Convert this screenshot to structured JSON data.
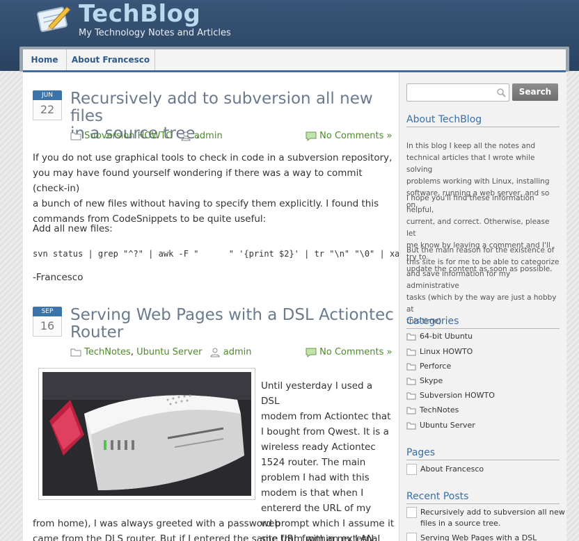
{
  "site": {
    "title": "TechBlog",
    "tagline": "My Technology Notes and Articles"
  },
  "nav": {
    "items": [
      "Home",
      "About Francesco"
    ]
  },
  "posts": [
    {
      "month": "JUN",
      "day": "22",
      "title_line1": "Recursively add to subversion all new files",
      "title_line2": "in a source tree.",
      "category": "Subversion HOWTO",
      "author": "admin",
      "comments": "No Comments »",
      "para1_lines": [
        "If you do not use graphical tools to check in code in a subversion repository,",
        "you may have found yourself wondering if there was a way to commit (check-in)",
        "a bunch of new files without having to specify them explicitly. I found this",
        "commands from CodeSnippets to be quite useful:"
      ],
      "para2": "Add all new files:",
      "code": "svn status | grep \"^?\" | awk -F \"      \" '{print $2}' | tr \"\\n\" \"\\0\" | xa",
      "signature": "-Francesco"
    },
    {
      "month": "SEP",
      "day": "16",
      "title_line1": "Serving Web Pages with a DSL Actiontec",
      "title_line2": "Router",
      "category1": "TechNotes",
      "category_sep": ",",
      "category2": "Ubuntu Server",
      "author": "admin",
      "comments": "No Comments »",
      "wrap_lines": [
        "Until yesterday I used a DSL",
        "modem from Actiontec that",
        "I bought from Qwest. It is a",
        "wireless ready Actiontec",
        "1524 router. The main",
        "problem I had with this",
        "modem is that when I",
        "entererd the URL of my web",
        "site from within my LAN (i.e."
      ],
      "full_lines": [
        "from home), I was always greeted with a password prompt which I assume it",
        "came from the DLS router. But if I entered the same URL from an external"
      ]
    }
  ],
  "sidebar": {
    "search_button": "Search",
    "search_placeholder": "",
    "about_heading": "About TechBlog",
    "about_paras": [
      [
        "In this blog I keep all the notes and",
        "technical articles that I wrote while solving",
        "problems working with Linux, installing",
        "software, running a web server, and so on."
      ],
      [
        "I hope you'll find these information helpful,",
        "current, and correct. Otherwise, please let",
        "me know by leaving a comment and I'll try to",
        "update the content as soon as possible."
      ],
      [
        "But the main reason for the existence of",
        "this site is for me to be able to categorize",
        "and save information for my administrative",
        "tasks (which by the way are just a hobby at",
        "this time)."
      ]
    ],
    "categories_heading": "Categories",
    "categories": [
      "64-bit Ubuntu",
      "Linux HOWTO",
      "Perforce",
      "Skype",
      "Subversion HOWTO",
      "TechNotes",
      "Ubuntu Server"
    ],
    "pages_heading": "Pages",
    "pages": [
      "About Francesco"
    ],
    "recent_heading": "Recent Posts",
    "recent": [
      [
        "Recursively add to subversion all new",
        "files in a source tree."
      ],
      [
        "Serving Web Pages with a DSL"
      ]
    ]
  },
  "colors": {
    "header_bg": "#2f4a68",
    "title_color": "#b9d9ee",
    "link_green": "#4c8a2a",
    "sidebar_heading": "#3a6ea5"
  }
}
